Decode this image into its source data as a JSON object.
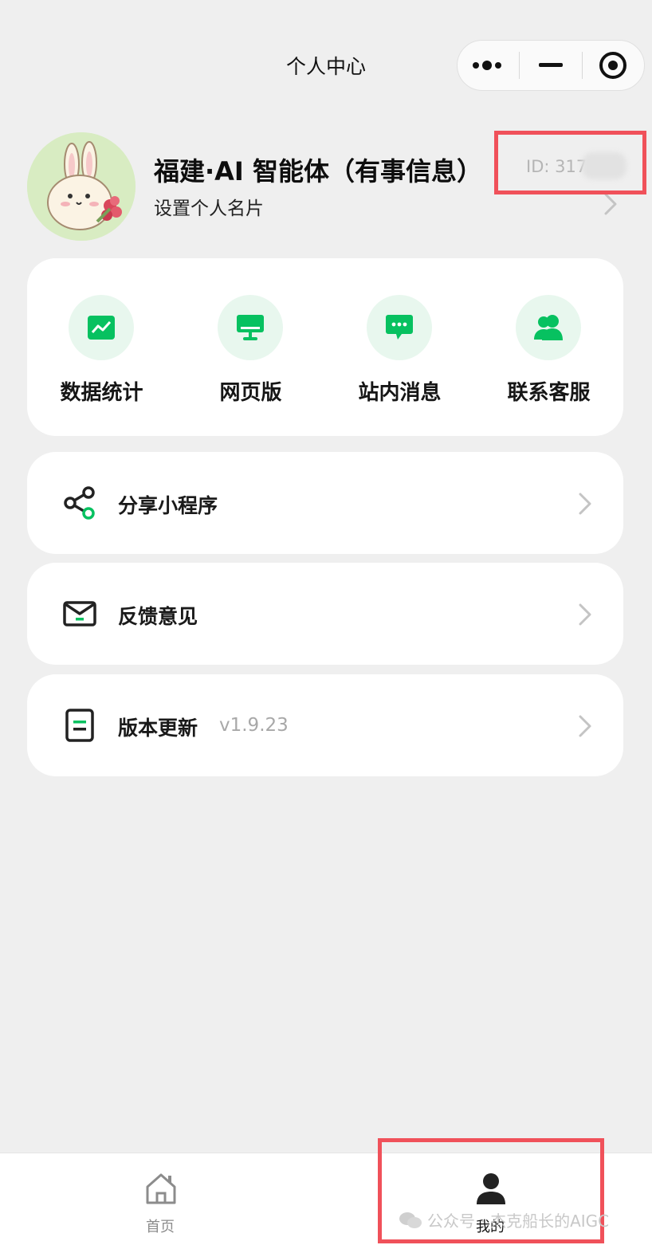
{
  "navbar": {
    "title": "个人中心",
    "capsule": {
      "more_icon": "more-dots-icon",
      "minimize_icon": "minus-icon",
      "close_icon": "target-circle-icon"
    }
  },
  "profile": {
    "name": "福建·AI 智能体（有事信息）",
    "subtitle": "设置个人名片",
    "id_text": "ID: 317"
  },
  "quick_actions": [
    {
      "label": "数据统计",
      "icon": "chart-line-icon"
    },
    {
      "label": "网页版",
      "icon": "monitor-icon"
    },
    {
      "label": "站内消息",
      "icon": "message-bubble-icon"
    },
    {
      "label": "联系客服",
      "icon": "customer-service-icon"
    }
  ],
  "menu": [
    {
      "label": "分享小程序",
      "icon": "share-icon"
    },
    {
      "label": "反馈意见",
      "icon": "mail-icon"
    },
    {
      "label": "版本更新",
      "icon": "document-icon",
      "value": "v1.9.23"
    }
  ],
  "tabbar": {
    "items": [
      {
        "label": "首页",
        "icon": "home-icon",
        "active": false
      },
      {
        "label": "我的",
        "icon": "user-icon",
        "active": true
      }
    ]
  },
  "watermark": {
    "text": "公众号 · 杰克船长的AIGC",
    "icon": "wechat-icon"
  },
  "colors": {
    "accent_green": "#07c160",
    "highlight_red": "#f0515a",
    "background": "#efefef"
  }
}
